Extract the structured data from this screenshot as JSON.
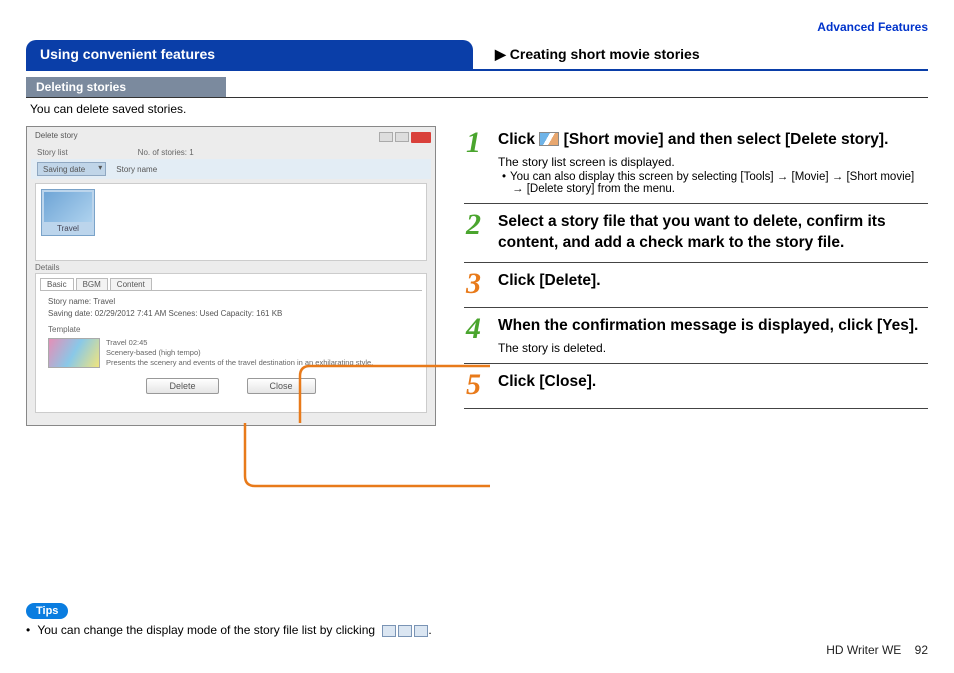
{
  "header": {
    "category_link": "Advanced Features",
    "tab_left": "Using convenient features",
    "tab_right_prefix": "▶",
    "tab_right": "Creating short movie stories",
    "subhead": "Deleting stories",
    "intro": "You can delete saved stories."
  },
  "screenshot": {
    "window_title": "Delete story",
    "col_storylist": "Story list",
    "col_numstories_label": "No. of stories:",
    "col_numstories_value": "1",
    "sort_label": "Saving date",
    "col_storyname": "Story name",
    "thumb_label": "Travel",
    "details_label": "Details",
    "tabs": {
      "basic": "Basic",
      "bgm": "BGM",
      "content": "Content"
    },
    "storyname_row": "Story name:  Travel",
    "detail_row": "Saving date:  02/29/2012 7:41 AM    Scenes:  Used    Capacity:  161 KB",
    "template_label": "Template",
    "tmpl_title": "Travel        02:45",
    "tmpl_line2": "Scenery-based (high tempo)",
    "tmpl_line3": "Presents the scenery and events of the travel destination in an exhilarating style.",
    "btn_delete": "Delete",
    "btn_close": "Close"
  },
  "steps": [
    {
      "num": "1",
      "numclass": "n1",
      "title_pre": "Click ",
      "title_post": " [Short movie] and then select [Delete story].",
      "sub": "The story list screen is displayed.",
      "note": "You can also display this screen by selecting [Tools] → [Movie] → [Short movie] → [Delete story] from the menu."
    },
    {
      "num": "2",
      "numclass": "n2",
      "title": "Select a story file that you want to delete, confirm its content, and add a check mark to the story file."
    },
    {
      "num": "3",
      "numclass": "n3",
      "title": "Click [Delete]."
    },
    {
      "num": "4",
      "numclass": "n4",
      "title": "When the confirmation message is displayed, click [Yes].",
      "sub": "The story is deleted."
    },
    {
      "num": "5",
      "numclass": "n5",
      "title": "Click [Close]."
    }
  ],
  "tips": {
    "badge": "Tips",
    "text": "You can change the display mode of the story file list by clicking"
  },
  "footer": {
    "product": "HD Writer WE",
    "page": "92"
  }
}
